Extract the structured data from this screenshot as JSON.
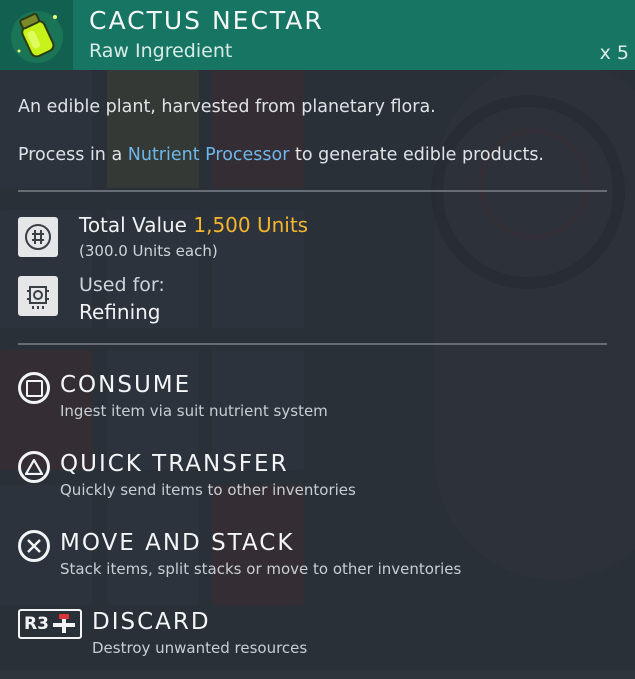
{
  "item": {
    "name": "CACTUS NECTAR",
    "category": "Raw Ingredient",
    "quantity": "x 5",
    "icon": "cactus-nectar-jar-icon",
    "accent_color": "#167563"
  },
  "description": {
    "line1": "An edible plant, harvested from planetary flora.",
    "line2_prefix": "Process in a ",
    "line2_link": "Nutrient Processor",
    "line2_suffix": " to generate edible products."
  },
  "value": {
    "label": "Total Value",
    "amount": "1,500 Units",
    "each": "(300.0 Units each)",
    "icon": "units-currency-icon",
    "amount_color": "#f5b52c"
  },
  "usage": {
    "label": "Used for:",
    "value": "Refining",
    "icon": "refiner-chip-icon"
  },
  "actions": [
    {
      "label": "CONSUME",
      "hint": "Ingest item via suit nutrient system",
      "button": "square-button-icon"
    },
    {
      "label": "QUICK TRANSFER",
      "hint": "Quickly send items to other inventories",
      "button": "triangle-button-icon"
    },
    {
      "label": "MOVE AND STACK",
      "hint": "Stack items, split stacks or move to other inventories",
      "button": "cross-button-icon"
    },
    {
      "label": "DISCARD",
      "hint": "Destroy unwanted resources",
      "button": "r3-button-icon",
      "button_text": "R3"
    }
  ]
}
